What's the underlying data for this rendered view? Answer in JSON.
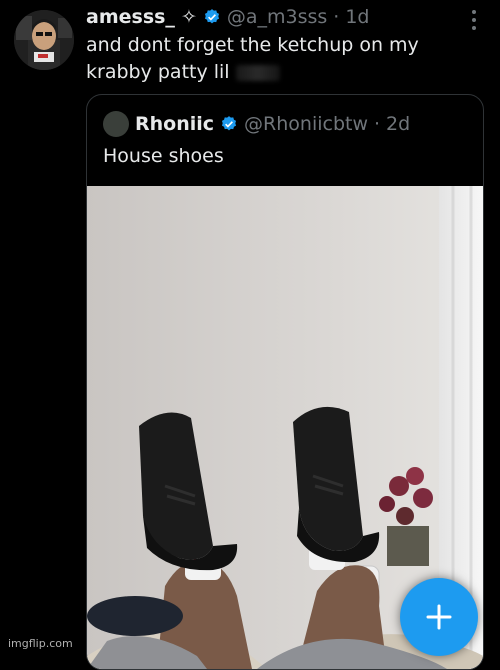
{
  "tweet": {
    "display_name": "amesss_",
    "sparkle_symbol": "✧",
    "handle": "@a_m3sss",
    "separator": "·",
    "age": "1d",
    "text_line1": "and dont forget the ketchup on my",
    "text_line2": "krabby patty lil"
  },
  "quoted": {
    "display_name": "Rhoniic",
    "handle": "@Rhoniicbtw",
    "separator": "·",
    "age": "2d",
    "text": "House shoes"
  },
  "fab": {
    "icon": "plus-icon"
  },
  "watermark": "imgflip.com",
  "colors": {
    "background": "#000000",
    "text": "#e7e9ea",
    "muted": "#71767b",
    "accent": "#1d9bf0"
  },
  "icons": [
    "verified-badge-icon",
    "more-options-icon",
    "plus-icon"
  ]
}
